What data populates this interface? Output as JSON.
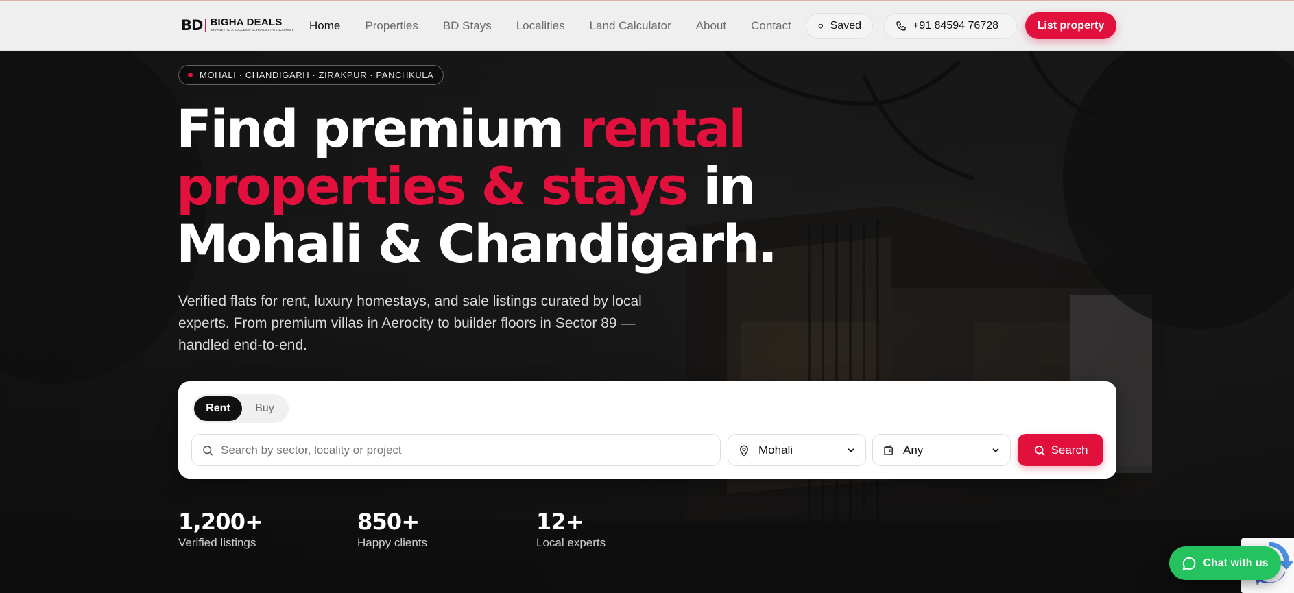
{
  "brand": {
    "mark": "BD",
    "name": "BIGHA DEALS",
    "tagline": "JOURNEY TO A SUCCESSFUL REAL ESTATE JOURNEY",
    "accent_color": "#e2103c"
  },
  "nav": {
    "links": [
      "Home",
      "Properties",
      "BD Stays",
      "Localities",
      "Land Calculator",
      "About",
      "Contact"
    ],
    "active": "Home",
    "saved_label": "Saved",
    "phone": "+91 84594 76728",
    "cta_label": "List property"
  },
  "hero": {
    "locations": "MOHALI · CHANDIGARH · ZIRAKPUR · PANCHKULA",
    "headline_part1": "Find premium ",
    "headline_accent": "rental properties & stays",
    "headline_part2": " in Mohali & Chandigarh.",
    "subtext": "Verified flats for rent, luxury homestays, and sale listings curated by local experts. From premium villas in Aerocity to builder floors in Sector 89 — handled end-to-end."
  },
  "search": {
    "modes": [
      "Rent",
      "Buy"
    ],
    "active_mode": "Rent",
    "placeholder": "Search by sector, locality or project",
    "query": "",
    "city": "Mohali",
    "budget": "Any",
    "button_label": "Search"
  },
  "stats": [
    {
      "value": "1,200+",
      "label": "Verified listings"
    },
    {
      "value": "850+",
      "label": "Happy clients"
    },
    {
      "value": "12+",
      "label": "Local experts"
    }
  ],
  "chat": {
    "label": "Chat with us",
    "color": "#25c260"
  },
  "icons": [
    "heart-icon",
    "phone-icon",
    "search-icon",
    "map-pin-icon",
    "wallet-icon",
    "chevron-down-icon",
    "chat-bubble-icon",
    "recaptcha-icon"
  ]
}
